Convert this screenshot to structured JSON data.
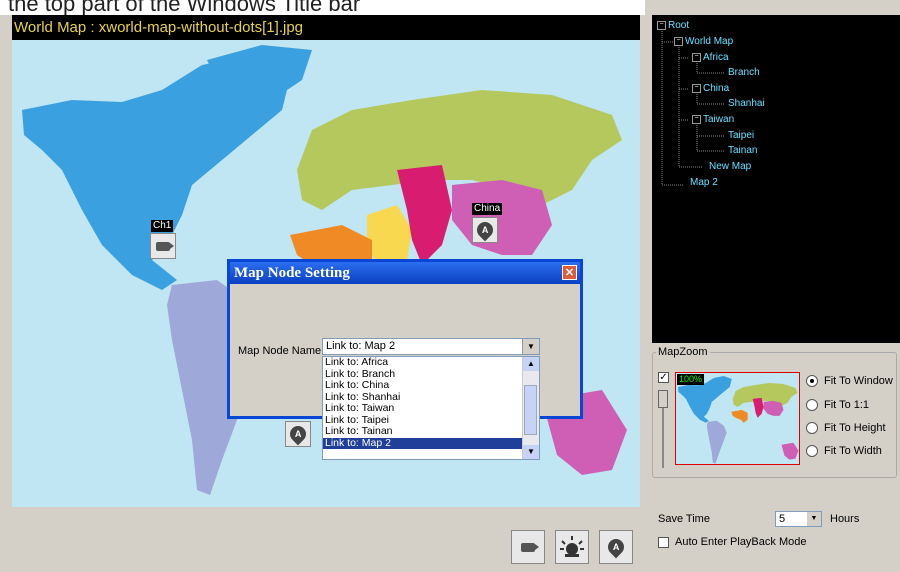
{
  "window": {
    "caption_fragment": "the top part of the Windows Title bar"
  },
  "map": {
    "title": "World Map : xworld-map-without-dots[1].jpg",
    "pins": {
      "ch1_label": "Ch1",
      "china_label": "China",
      "pin_glyph": "A"
    },
    "colors": {
      "ocean": "#bfe6f2",
      "north_america": "#3aa0e0",
      "south_america": "#9fa9d9",
      "europe_asia": "#b5c85e",
      "china": "#cf5fb4",
      "india": "#d81c70",
      "mideast": "#f7d84e",
      "africa": "#f08a25"
    }
  },
  "dialog": {
    "title": "Map Node Setting",
    "close_glyph": "✕",
    "field_label": "Map Node Name",
    "combo_value": "Link to: Map 2",
    "arrow_glyph": "▼",
    "options": [
      "Link to: Africa",
      "Link to: Branch",
      "Link to: China",
      "Link to: Shanhai",
      "Link to: Taiwan",
      "Link to: Taipei",
      "Link to: Tainan",
      "Link to: Map 2"
    ],
    "selected_index": 7
  },
  "tree": {
    "root": "Root",
    "world_map": "World Map",
    "africa": "Africa",
    "branch": "Branch",
    "china": "China",
    "shanhai": "Shanhai",
    "taiwan": "Taiwan",
    "taipei": "Taipei",
    "tainan": "Tainan",
    "new_map": "New Map",
    "map2": "Map 2",
    "collapse_glyph": "−"
  },
  "mapzoom": {
    "legend": "MapZoom",
    "enabled": true,
    "check_glyph": "✓",
    "zoom_percent": "100%",
    "options": [
      "Fit To Window",
      "Fit To 1:1",
      "Fit To Height",
      "Fit To Width"
    ],
    "selected_option": 0
  },
  "save": {
    "label": "Save Time",
    "value": "5",
    "unit": "Hours",
    "auto_enter_label": "Auto Enter PlayBack Mode",
    "auto_enter_checked": false
  },
  "toolbar": {
    "buttons": [
      "camera-icon",
      "alarm-icon",
      "map-pin-icon"
    ]
  }
}
